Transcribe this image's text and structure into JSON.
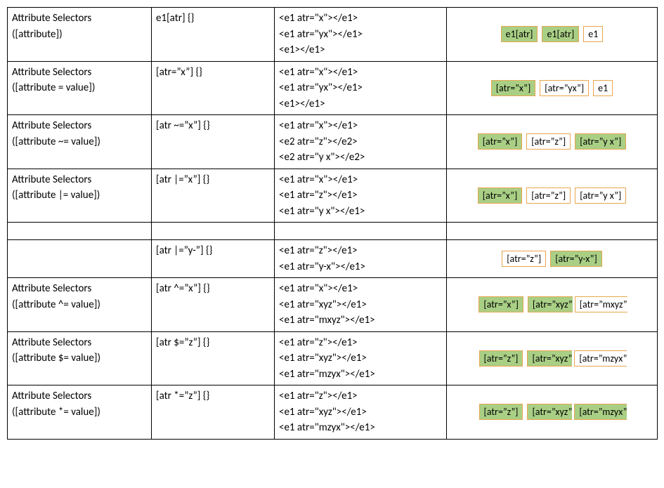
{
  "rows": [
    {
      "name_line1": "Attribute Selectors",
      "name_line2": "([attribute])",
      "selector": "e1[atr] {}",
      "html": [
        "<e1 atr=\"x\"></e1>",
        "<e1 atr=\"yx\"></e1>",
        "<e1></e1>"
      ],
      "chips": [
        {
          "label": "e1[atr]",
          "match": true,
          "cut": false
        },
        {
          "label": "e1[atr]",
          "match": true,
          "cut": false
        },
        {
          "label": "e1",
          "match": false,
          "cut": false
        }
      ]
    },
    {
      "name_line1": "Attribute Selectors",
      "name_line2": "([attribute = value])",
      "selector": "[atr=”x”] {}",
      "html": [
        "<e1 atr=\"x\"></e1>",
        "<e1 atr=\"yx\"></e1>",
        "<e1></e1>"
      ],
      "chips": [
        {
          "label": "[atr=”x”]",
          "match": true,
          "cut": false
        },
        {
          "label": "[atr=”yx”]",
          "match": false,
          "cut": false
        },
        {
          "label": "e1",
          "match": false,
          "cut": false
        }
      ]
    },
    {
      "name_line1": "Attribute Selectors",
      "name_line2": "([attribute ~= value])",
      "selector": "[atr ~=”x”] {}",
      "html": [
        "<e1 atr=\"x\"></e1>",
        "<e2 atr=\"z\"></e2>",
        "<e2 atr=\"y x\"></e2>"
      ],
      "chips": [
        {
          "label": "[atr=”x”]",
          "match": true,
          "cut": false
        },
        {
          "label": "[atr=”z”]",
          "match": false,
          "cut": false
        },
        {
          "label": "[atr=”y x”]",
          "match": true,
          "cut": false
        }
      ]
    },
    {
      "name_line1": "Attribute Selectors",
      "name_line2": "([attribute |= value])",
      "selector": "[atr |=”x”] {}",
      "html": [
        "<e1 atr=\"x\"></e1>",
        "<e1 atr=\"z\"></e1>",
        "<e1 atr=\"y x\"></e1>"
      ],
      "chips": [
        {
          "label": "[atr=”x”]",
          "match": true,
          "cut": false
        },
        {
          "label": "[atr=”z”]",
          "match": false,
          "cut": false
        },
        {
          "label": "[atr=”y x”]",
          "match": false,
          "cut": false
        }
      ]
    },
    {
      "spacer": true
    },
    {
      "name_line1": "",
      "name_line2": "",
      "selector": "[atr |=”y-”] {}",
      "html": [
        "<e1 atr=\"z\"></e1>",
        "<e1 atr=\"y-x\"></e1>"
      ],
      "chips": [
        {
          "label": "[atr=”z”]",
          "match": false,
          "cut": false
        },
        {
          "label": "[atr=”y-x”]",
          "match": true,
          "cut": false
        }
      ]
    },
    {
      "name_line1": "Attribute Selectors",
      "name_line2": "([attribute ^= value])",
      "selector": "[atr ^=”x”] {}",
      "html": [
        "<e1 atr=\"x\"></e1>",
        "<e1 atr=\"xyz\"></e1>",
        "<e1 atr=\"mxyz\"></e1>"
      ],
      "chips": [
        {
          "label": "[atr=”x”]",
          "match": true,
          "cut": false
        },
        {
          "label": "[atr=”xyz”",
          "match": true,
          "cut": true
        },
        {
          "label": "[atr=”mxyz”",
          "match": false,
          "cut": true
        }
      ]
    },
    {
      "name_line1": "Attribute Selectors",
      "name_line2": "([attribute $= value])",
      "selector": "[atr $=”z”] {}",
      "html": [
        "<e1 atr=\"z\"></e1>",
        "<e1 atr=\"xyz\"></e1>",
        "<e1 atr=\"mzyx\"></e1>"
      ],
      "chips": [
        {
          "label": "[atr=”z”]",
          "match": true,
          "cut": false
        },
        {
          "label": "[atr=”xyz”",
          "match": true,
          "cut": true
        },
        {
          "label": "[atr=”mzyx”",
          "match": false,
          "cut": true
        }
      ]
    },
    {
      "name_line1": "Attribute Selectors",
      "name_line2": "([attribute *= value])",
      "selector": "[atr *=”z”] {}",
      "html": [
        "<e1 atr=\"z\"></e1>",
        "<e1 atr=\"xyz\"></e1>",
        "<e1 atr=\"mzyx\"></e1>"
      ],
      "chips": [
        {
          "label": "[atr=”z”]",
          "match": true,
          "cut": false
        },
        {
          "label": "[atr=”xyz”",
          "match": true,
          "cut": true
        },
        {
          "label": "[atr=”mzyx”",
          "match": true,
          "cut": true
        }
      ]
    }
  ]
}
